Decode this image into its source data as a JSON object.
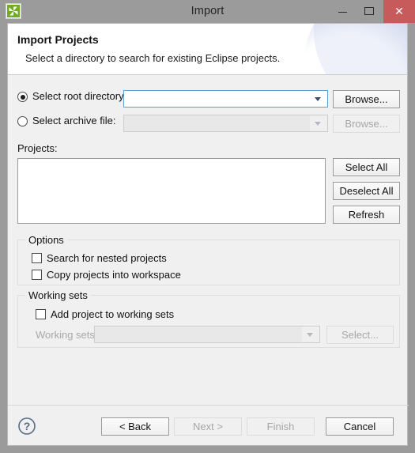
{
  "window": {
    "title": "Import",
    "icon": "eclipse-import-icon",
    "controls": {
      "minimize": "minimize-icon",
      "maximize": "maximize-icon",
      "close": "✕"
    },
    "close_color": "#c75b5b"
  },
  "header": {
    "title": "Import Projects",
    "subtitle": "Select a directory to search for existing Eclipse projects."
  },
  "source": {
    "root_directory": {
      "label": "Select root directory:",
      "selected": true,
      "value": "",
      "browse_label": "Browse...",
      "enabled": true
    },
    "archive_file": {
      "label": "Select archive file:",
      "selected": false,
      "value": "",
      "browse_label": "Browse...",
      "enabled": false
    }
  },
  "projects": {
    "label": "Projects:",
    "items": [],
    "buttons": [
      {
        "label": "Select All",
        "name": "select-all-button",
        "enabled": true
      },
      {
        "label": "Deselect All",
        "name": "deselect-all-button",
        "enabled": true
      },
      {
        "label": "Refresh",
        "name": "refresh-button",
        "enabled": true
      }
    ]
  },
  "options": {
    "title": "Options",
    "checkboxes": [
      {
        "label": "Search for nested projects",
        "checked": false
      },
      {
        "label": "Copy projects into workspace",
        "checked": false
      }
    ]
  },
  "working_sets": {
    "title": "Working sets",
    "add_checkbox": {
      "label": "Add project to working sets",
      "checked": false
    },
    "combo_label": "Working sets:",
    "combo_value": "",
    "select_label": "Select...",
    "enabled": false
  },
  "footer": {
    "help": "help-icon",
    "buttons": [
      {
        "label": "< Back",
        "name": "back-button",
        "enabled": true
      },
      {
        "label": "Next >",
        "name": "next-button",
        "enabled": false
      },
      {
        "label": "Finish",
        "name": "finish-button",
        "enabled": false
      },
      {
        "label": "Cancel",
        "name": "cancel-button",
        "enabled": true
      }
    ]
  }
}
